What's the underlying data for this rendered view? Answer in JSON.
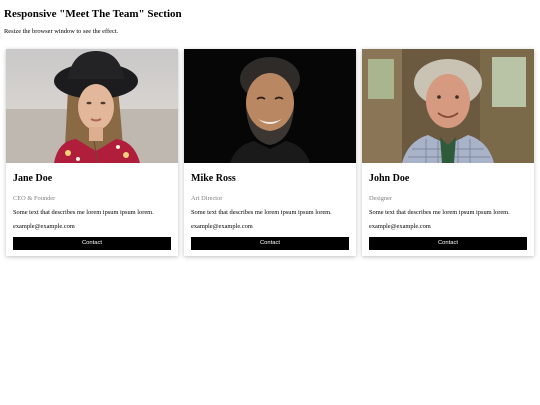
{
  "page": {
    "title": "Responsive \"Meet The Team\" Section",
    "subtitle": "Resize the browser window to see the effect."
  },
  "team": [
    {
      "name": "Jane Doe",
      "role": "CEO & Founder",
      "description": "Some text that describes me lorem ipsum ipsum lorem.",
      "email": "example@example.com",
      "button_label": "Contact"
    },
    {
      "name": "Mike Ross",
      "role": "Art Director",
      "description": "Some text that describes me lorem ipsum ipsum lorem.",
      "email": "example@example.com",
      "button_label": "Contact"
    },
    {
      "name": "John Doe",
      "role": "Designer",
      "description": "Some text that describes me lorem ipsum ipsum lorem.",
      "email": "example@example.com",
      "button_label": "Contact"
    }
  ],
  "colors": {
    "button_bg": "#000000",
    "button_text": "#ffffff",
    "role_text": "#808080"
  }
}
